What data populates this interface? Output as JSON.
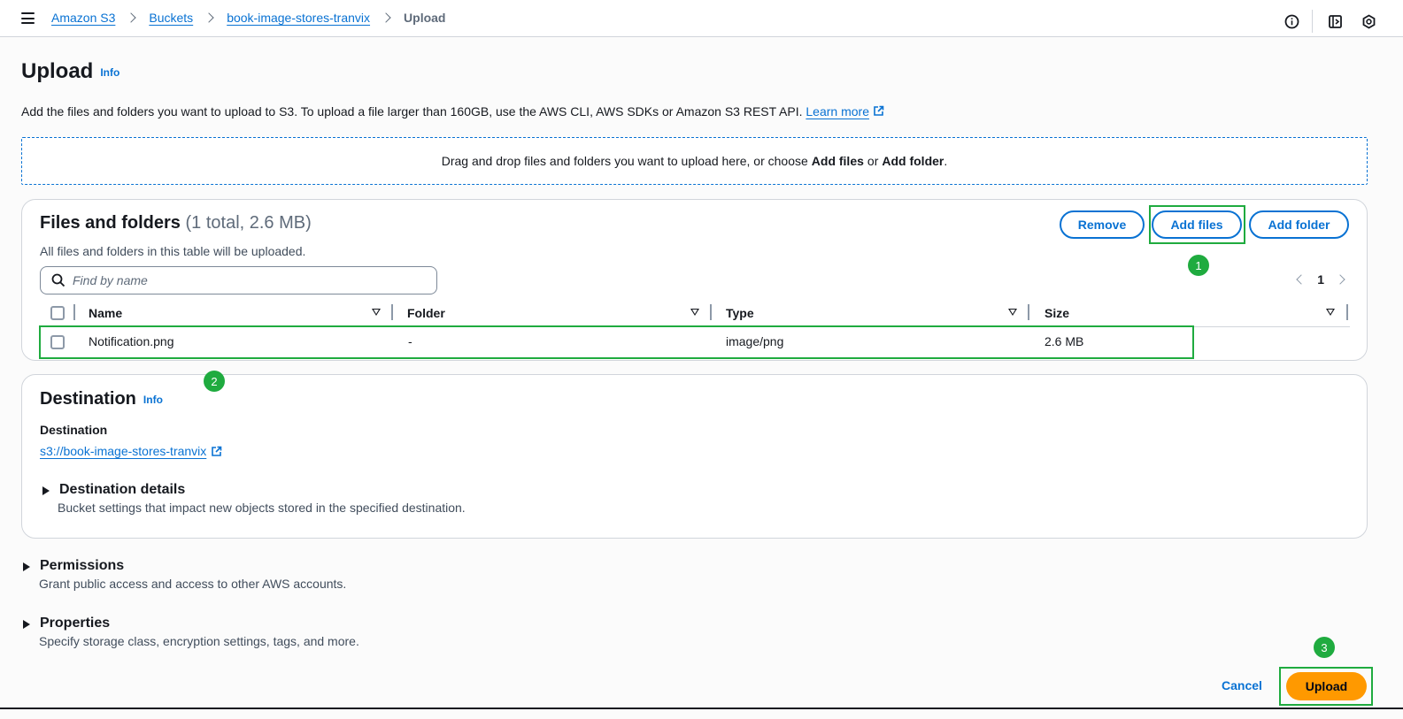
{
  "breadcrumb": {
    "items": [
      "Amazon S3",
      "Buckets",
      "book-image-stores-tranvix"
    ],
    "current": "Upload"
  },
  "header": {
    "title": "Upload",
    "info": "Info",
    "description": "Add the files and folders you want to upload to S3. To upload a file larger than 160GB, use the AWS CLI, AWS SDKs or Amazon S3 REST API.",
    "learn_more": "Learn more"
  },
  "dropzone": {
    "text_before": "Drag and drop files and folders you want to upload here, or choose",
    "add_files": "Add files",
    "or": "or",
    "add_folder": "Add folder",
    "end": "."
  },
  "files": {
    "title": "Files and folders",
    "counter": "(1 total, 2.6 MB)",
    "subtitle": "All files and folders in this table will be uploaded.",
    "buttons": {
      "remove": "Remove",
      "add_files": "Add files",
      "add_folder": "Add folder"
    },
    "search_placeholder": "Find by name",
    "page": "1",
    "columns": [
      "Name",
      "Folder",
      "Type",
      "Size"
    ],
    "rows": [
      {
        "name": "Notification.png",
        "folder": "-",
        "type": "image/png",
        "size": "2.6 MB"
      }
    ]
  },
  "destination": {
    "title": "Destination",
    "info": "Info",
    "label": "Destination",
    "link": "s3://book-image-stores-tranvix",
    "details_title": "Destination details",
    "details_sub": "Bucket settings that impact new objects stored in the specified destination."
  },
  "permissions": {
    "title": "Permissions",
    "sub": "Grant public access and access to other AWS accounts."
  },
  "properties": {
    "title": "Properties",
    "sub": "Specify storage class, encryption settings, tags, and more."
  },
  "footer": {
    "cancel": "Cancel",
    "upload": "Upload"
  },
  "annotations": [
    "1",
    "2",
    "3"
  ],
  "colors": {
    "link": "#0972d3",
    "primary_button": "#ff9900",
    "annotation": "#1fab3f"
  }
}
